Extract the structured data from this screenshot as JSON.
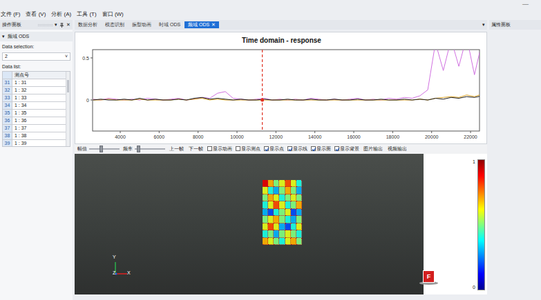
{
  "window": {
    "minimize": "—"
  },
  "menu": [
    "文件 (F)",
    "查看 (V)",
    "分析 (A)",
    "工具 (T)",
    "窗口 (W)"
  ],
  "left_panel": {
    "title": "操作面板",
    "menu": "▾",
    "close": "✕",
    "section": {
      "arrow": "▾",
      "title": "频域 ODS"
    },
    "data_selection_label": "Data selection:",
    "data_selection_value": "2",
    "dropdown_arrow": "˅",
    "data_list_label": "Data list:",
    "table": {
      "columns": [
        "测点号"
      ],
      "rows": [
        {
          "index": "31",
          "value": "1 : 31"
        },
        {
          "index": "32",
          "value": "1 : 32"
        },
        {
          "index": "33",
          "value": "1 : 33"
        },
        {
          "index": "34",
          "value": "1 : 34"
        },
        {
          "index": "35",
          "value": "1 : 35"
        },
        {
          "index": "36",
          "value": "1 : 36"
        },
        {
          "index": "37",
          "value": "1 : 37"
        },
        {
          "index": "38",
          "value": "1 : 38"
        },
        {
          "index": "39",
          "value": "1 : 39"
        }
      ]
    }
  },
  "tabs": [
    {
      "label": "数据分析",
      "selected": false
    },
    {
      "label": "模态识别",
      "selected": false
    },
    {
      "label": "振型动画",
      "selected": false
    },
    {
      "label": "时域 ODS",
      "selected": false
    },
    {
      "label": "频域 ODS",
      "selected": true,
      "close": "✕"
    }
  ],
  "tab_menu": "▾",
  "right_panel": {
    "title": "属性面板"
  },
  "chart": {
    "title": "Time domain - response",
    "y_ticks": [
      "0.5",
      "0"
    ],
    "x_ticks": [
      "4000",
      "6000",
      "8000",
      "10000",
      "12000",
      "14000",
      "16000",
      "18000",
      "20000",
      "22000"
    ],
    "cursor": 11300,
    "x": [
      2600,
      3000,
      3400,
      3800,
      4200,
      4600,
      5000,
      5400,
      5800,
      6200,
      6600,
      7000,
      7400,
      7800,
      8200,
      8600,
      9000,
      9400,
      9800,
      10200,
      10600,
      11000,
      11400,
      11800,
      12200,
      12600,
      13000,
      13400,
      13800,
      14200,
      14600,
      15000,
      15400,
      15800,
      16200,
      16600,
      17000,
      17400,
      17800,
      18200,
      18600,
      19000,
      19400,
      19800,
      20200,
      20600,
      21000,
      21400,
      21800,
      22200,
      22600
    ],
    "series": [
      {
        "color": "#d070e0",
        "values": [
          0.01,
          0.0,
          0.02,
          0.01,
          0.0,
          0.01,
          0.0,
          0.02,
          0.01,
          0.0,
          0.01,
          0.02,
          0.0,
          0.01,
          0.03,
          0.02,
          0.08,
          0.1,
          0.02,
          0.01,
          0.0,
          0.01,
          0.02,
          0.0,
          0.01,
          0.0,
          0.01,
          0.0,
          0.02,
          0.01,
          0.0,
          0.01,
          0.0,
          0.01,
          0.02,
          0.0,
          0.01,
          0.0,
          0.02,
          0.01,
          0.03,
          0.02,
          0.05,
          0.12,
          0.68,
          0.35,
          0.72,
          0.4,
          0.75,
          0.3,
          0.7
        ]
      },
      {
        "color": "#d9a020",
        "values": [
          0.0,
          0.0,
          0.01,
          0.0,
          0.0,
          0.0,
          0.01,
          0.0,
          0.0,
          0.0,
          0.0,
          0.01,
          0.0,
          0.01,
          0.02,
          0.0,
          0.01,
          0.0,
          0.0,
          0.0,
          0.0,
          0.0,
          0.0,
          0.0,
          0.0,
          0.0,
          0.0,
          0.0,
          0.0,
          0.0,
          0.0,
          0.0,
          0.0,
          0.0,
          0.0,
          0.0,
          0.0,
          0.0,
          0.0,
          0.0,
          0.0,
          0.0,
          0.01,
          0.0,
          0.02,
          0.03,
          0.04,
          0.03,
          0.06,
          0.04,
          0.07
        ]
      },
      {
        "color": "#1a1a1a",
        "values": [
          0.0,
          0.01,
          0.0,
          0.0,
          0.01,
          0.0,
          0.02,
          0.0,
          0.01,
          0.0,
          0.0,
          0.01,
          0.0,
          0.02,
          0.03,
          0.01,
          0.02,
          0.01,
          0.0,
          0.01,
          0.0,
          0.0,
          0.01,
          0.0,
          0.0,
          0.01,
          0.0,
          0.0,
          0.01,
          0.0,
          0.0,
          0.01,
          0.0,
          0.0,
          0.01,
          0.0,
          0.0,
          0.01,
          0.0,
          0.0,
          0.01,
          0.0,
          0.01,
          0.0,
          0.02,
          0.01,
          0.03,
          0.02,
          0.04,
          0.03,
          0.05
        ]
      }
    ]
  },
  "toolbar": [
    {
      "kind": "slider",
      "label": "幅值",
      "level": 0.38
    },
    {
      "kind": "slider",
      "label": "频率",
      "level": 0.12
    },
    {
      "kind": "button",
      "label": "上一帧"
    },
    {
      "kind": "button",
      "label": "下一帧"
    },
    {
      "kind": "checkbox",
      "label": "显示动画",
      "checked": false
    },
    {
      "kind": "checkbox",
      "label": "显示测点",
      "checked": false
    },
    {
      "kind": "checkbox",
      "label": "显示点",
      "checked": true
    },
    {
      "kind": "checkbox",
      "label": "显示线",
      "checked": true
    },
    {
      "kind": "checkbox",
      "label": "显示面",
      "checked": true
    },
    {
      "kind": "checkbox",
      "label": "显示背景",
      "checked": true
    },
    {
      "kind": "button",
      "label": "图片输出"
    },
    {
      "kind": "button",
      "label": "视频输出"
    }
  ],
  "viewer": {
    "mesh": [
      [
        0.9,
        0.7,
        0.5,
        0.6,
        0.8,
        0.6,
        0.4
      ],
      [
        0.6,
        0.4,
        0.3,
        0.5,
        0.7,
        0.5,
        0.3
      ],
      [
        0.5,
        0.7,
        0.6,
        0.4,
        0.5,
        0.6,
        0.5
      ],
      [
        0.4,
        0.6,
        0.8,
        0.6,
        0.4,
        0.5,
        0.7
      ],
      [
        0.3,
        0.2,
        0.4,
        0.5,
        0.6,
        0.2,
        0.3
      ],
      [
        0.5,
        0.6,
        0.7,
        0.5,
        0.4,
        0.3,
        0.5
      ],
      [
        0.6,
        0.8,
        0.6,
        0.3,
        0.2,
        0.4,
        0.6
      ],
      [
        0.4,
        0.5,
        0.3,
        0.5,
        0.6,
        0.5,
        0.4
      ],
      [
        0.7,
        0.6,
        0.5,
        0.4,
        0.6,
        0.7,
        0.5
      ]
    ],
    "axes": {
      "y": "Y",
      "z": "Z",
      "x": "X"
    },
    "force_label": "F",
    "colorbar": {
      "max": "1",
      "min": "0"
    }
  }
}
